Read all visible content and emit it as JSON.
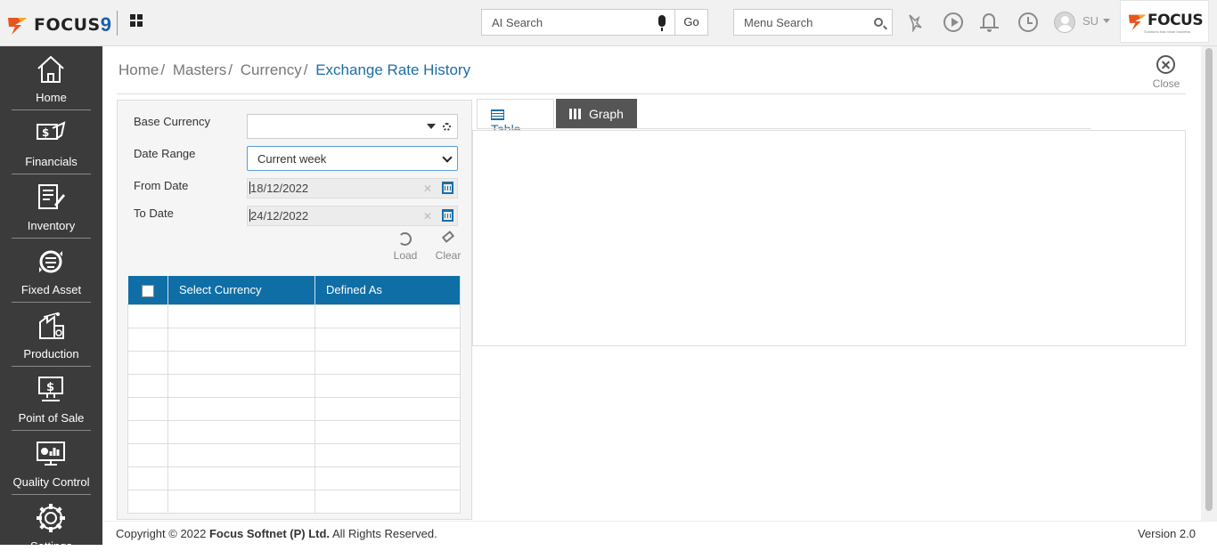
{
  "app": {
    "logo_text": "FOCUS",
    "logo_number": "9",
    "brand_text": "FOCUS",
    "brand_tagline": "Solutions that mean business"
  },
  "topbar": {
    "ai_search_placeholder": "AI Search",
    "go_label": "Go",
    "menu_search_placeholder": "Menu Search",
    "user_initials": "SU",
    "icons": [
      "grid-icon",
      "mic-icon",
      "search-icon",
      "bird-icon",
      "play-icon",
      "bell-icon",
      "history-icon",
      "user-avatar-icon",
      "caret-down-icon"
    ]
  },
  "sidebar": {
    "items": [
      {
        "label": "Home",
        "icon": "home-icon"
      },
      {
        "label": "Financials",
        "icon": "financials-icon"
      },
      {
        "label": "Inventory",
        "icon": "inventory-icon"
      },
      {
        "label": "Fixed Asset",
        "icon": "fixed-asset-icon"
      },
      {
        "label": "Production",
        "icon": "production-icon"
      },
      {
        "label": "Point of Sale",
        "icon": "point-of-sale-icon"
      },
      {
        "label": "Quality Control",
        "icon": "quality-control-icon"
      },
      {
        "label": "Settings",
        "icon": "settings-icon"
      }
    ]
  },
  "breadcrumb": {
    "items": [
      "Home",
      "Masters",
      "Currency"
    ],
    "separator": "/",
    "current": "Exchange Rate History"
  },
  "close": {
    "label": "Close"
  },
  "form": {
    "base_currency_label": "Base Currency",
    "base_currency_value": "",
    "date_range_label": "Date Range",
    "date_range_value": "Current week",
    "from_date_label": "From Date",
    "from_date_value": "18/12/2022",
    "to_date_label": "To Date",
    "to_date_value": "24/12/2022",
    "load_label": "Load",
    "clear_label": "Clear"
  },
  "currency_table": {
    "columns": [
      "Select Currency",
      "Defined As"
    ],
    "rows": 9
  },
  "tabs": {
    "table_label": "Table",
    "graph_label": "Graph",
    "active": "Table"
  },
  "footer": {
    "copyright_prefix": "Copyright © 2022",
    "company": "Focus Softnet (P) Ltd.",
    "rights": "All Rights Reserved.",
    "version": "Version 2.0"
  },
  "colors": {
    "accent": "#0f6ea6",
    "sidebar_bg": "#3b3b3b",
    "graph_tab_bg": "#555555"
  }
}
